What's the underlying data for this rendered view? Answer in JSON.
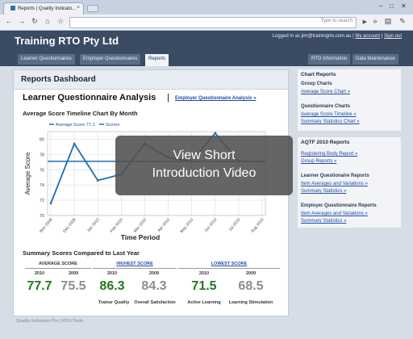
{
  "browser": {
    "tab_title": "Reports | Quality Indicato...",
    "tab_close": "×",
    "search_placeholder": "Type to search",
    "back_icon": "back-arrow-icon",
    "forward_icon": "forward-arrow-icon",
    "reload_icon": "reload-icon",
    "home_icon": "home-icon",
    "star_icon": "star-icon"
  },
  "site": {
    "title": "Training RTO Pty Ltd",
    "logged_in_text": "Logged in as jim@trainingrto.com.au",
    "my_account": "My account",
    "sign_out": "Sign out",
    "nav_left": [
      "Learner Questionnaires",
      "Employer Questionnaires",
      "Reports"
    ],
    "nav_right": [
      "RTO Information",
      "Data Maintenance"
    ],
    "active_tab": "Reports"
  },
  "main": {
    "dashboard_title": "Reports Dashboard",
    "section_title": "Learner Questionnaire Analysis",
    "separator": "|",
    "employer_link": "Employer Questionnaire Analysis »",
    "chart_title": "Average Score Timeline Chart By Month"
  },
  "chart_data": {
    "type": "line",
    "legend": [
      "Average Score 77.1",
      "Scores"
    ],
    "xlabel": "Time Period",
    "ylabel": "Average Score",
    "categories": [
      "Nov 2008",
      "Dec 2008",
      "Jan 2010",
      "Feb 2010",
      "Mar 2010",
      "Apr 2010",
      "May 2010",
      "Jun 2010",
      "Jul 2010",
      "Aug 2010"
    ],
    "ylim": [
      70,
      81
    ],
    "yticks": [
      70,
      72,
      74,
      76,
      78,
      80
    ],
    "series": [
      {
        "name": "Scores",
        "values": [
          71.6,
          79.4,
          74.6,
          75.4,
          79.4,
          77.6,
          77.1,
          80.8,
          77.1,
          77.1
        ]
      },
      {
        "name": "Average Score 77.1",
        "values": [
          77.1,
          77.1,
          77.1,
          77.1,
          77.1,
          77.1,
          77.1,
          77.1,
          77.1,
          77.1
        ]
      }
    ],
    "colors": {
      "line": "#1f6fb0",
      "grid": "#d9dde3"
    }
  },
  "summary": {
    "title": "Summary Scores Compared to Last Year",
    "groups": [
      {
        "header": "AVERAGE SCORE",
        "is_link": false
      },
      {
        "header": "HIGHEST SCORE",
        "is_link": true
      },
      {
        "header": "LOWEST SCORE",
        "is_link": true
      }
    ],
    "year_current": "2010",
    "year_previous": "2009",
    "scores": [
      {
        "value": "77.7",
        "kind": "cur"
      },
      {
        "value": "75.5",
        "kind": "prev"
      },
      {
        "value": "86.3",
        "kind": "cur"
      },
      {
        "value": "84.3",
        "kind": "prev"
      },
      {
        "value": "71.5",
        "kind": "cur"
      },
      {
        "value": "68.5",
        "kind": "prev"
      }
    ],
    "metrics": [
      "Trainer Quality",
      "Overall Satisfaction",
      "Active Learning",
      "Learning Stimulation"
    ]
  },
  "sidebar": {
    "chart_reports": {
      "heading": "Chart Reports",
      "group_charts": "Group Charts",
      "average_score_chart": "Average Score Chart »",
      "questionnaire_charts": "Questionnaire Charts",
      "average_score_timeline": "Average Score Timeline »",
      "summary_statistics_chart": "Summary Statistics Chart »"
    },
    "aqtf": {
      "heading": "AQTF 2010 Reports",
      "registering_body": "Registering Body Report »",
      "group_reports": "Group Reports »",
      "learner_heading": "Learner Questionaire Reports",
      "learner_items": "Item Averages and Variations »",
      "learner_summary": "Summary Statistics »",
      "employer_heading": "Employer Questionnaire Reports",
      "employer_items": "Item Averages and Variations »",
      "employer_summary": "Summary Statistics »"
    }
  },
  "footer": "Quality Indicators Pro | RTO Tools",
  "overlay": {
    "line1": "View Short",
    "line2": "Introduction Video"
  }
}
